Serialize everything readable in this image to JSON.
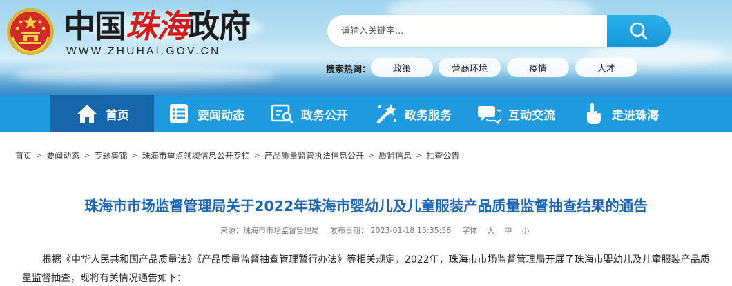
{
  "header": {
    "logo_title_part1": "中国",
    "logo_title_part2": "珠海",
    "logo_title_part3": "政府",
    "logo_url": "WWW.ZHUHAI.GOV.CN",
    "search": {
      "placeholder": "请输入关键字..."
    },
    "hot_label": "搜索热词：",
    "hot_tags": [
      "政策",
      "营商环境",
      "疫情",
      "人才"
    ]
  },
  "nav": {
    "items": [
      {
        "label": "首页",
        "icon": "home-icon",
        "active": true
      },
      {
        "label": "要闻动态",
        "icon": "news-list-icon"
      },
      {
        "label": "政务公开",
        "icon": "open-gov-icon"
      },
      {
        "label": "政务服务",
        "icon": "service-icon"
      },
      {
        "label": "互动交流",
        "icon": "chat-icon"
      },
      {
        "label": "走进珠海",
        "icon": "hand-icon"
      }
    ]
  },
  "breadcrumb": [
    "首页",
    "要闻动态",
    "专题集锦",
    "珠海市重点领域信息公开专栏",
    "产品质量监管执法信息公开",
    "质监信息",
    "抽查公告"
  ],
  "article": {
    "title": "珠海市市场监督管理局关于2022年珠海市婴幼儿及儿童服装产品质量监督抽查结果的通告",
    "source": "来源：珠海市市场监督管理局",
    "date": "发布日期： 2023-01-18 15:35:58",
    "font_label": "字体",
    "font_sizes": [
      "大",
      "中",
      "小"
    ],
    "paragraph": "根据《中华人民共和国产品质量法》《产品质量监督抽查管理暂行办法》等相关规定，2022年，珠海市市场监督管理局开展了珠海市婴幼儿及儿童服装产品质量监督抽查，现将有关情况通告如下："
  },
  "colors": {
    "nav_bg": "#1f9ade",
    "nav_active": "#1666a9",
    "title_blue": "#1d64ad",
    "logo_red": "#d21c1c",
    "search_button": "#1797d7"
  }
}
